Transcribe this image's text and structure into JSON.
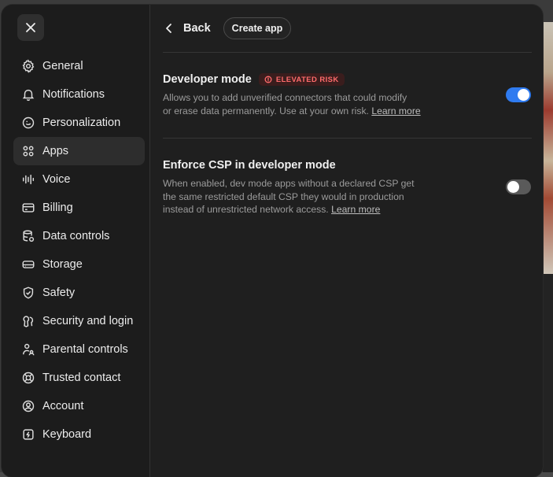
{
  "sidebar": {
    "items": [
      {
        "label": "General",
        "icon": "gear-icon"
      },
      {
        "label": "Notifications",
        "icon": "bell-icon"
      },
      {
        "label": "Personalization",
        "icon": "personalization-icon"
      },
      {
        "label": "Apps",
        "icon": "apps-grid-icon",
        "active": true
      },
      {
        "label": "Voice",
        "icon": "voice-wave-icon"
      },
      {
        "label": "Billing",
        "icon": "credit-card-icon"
      },
      {
        "label": "Data controls",
        "icon": "database-icon"
      },
      {
        "label": "Storage",
        "icon": "storage-icon"
      },
      {
        "label": "Safety",
        "icon": "shield-icon"
      },
      {
        "label": "Security and login",
        "icon": "key-icon"
      },
      {
        "label": "Parental controls",
        "icon": "parent-icon"
      },
      {
        "label": "Trusted contact",
        "icon": "lifebuoy-icon"
      },
      {
        "label": "Account",
        "icon": "account-icon"
      },
      {
        "label": "Keyboard",
        "icon": "keyboard-icon"
      }
    ]
  },
  "header": {
    "back_label": "Back",
    "create_label": "Create app"
  },
  "settings": {
    "developer_mode": {
      "title": "Developer mode",
      "badge": "ELEVATED RISK",
      "desc_line1": "Allows you to add unverified connectors that could modify",
      "desc_line2": "or erase data permanently. Use at your own risk.",
      "link": "Learn more",
      "enabled": true
    },
    "enforce_csp": {
      "title": "Enforce CSP in developer mode",
      "desc_line1": "When enabled, dev mode apps without a declared CSP get",
      "desc_line2": "the same restricted default CSP they would in production",
      "desc_line3": "instead of unrestricted network access.",
      "link": "Learn more",
      "enabled": false
    }
  },
  "colors": {
    "toggle_on": "#2f7bf0",
    "toggle_off": "#5a5a5a",
    "risk": "#ff6b6b"
  }
}
